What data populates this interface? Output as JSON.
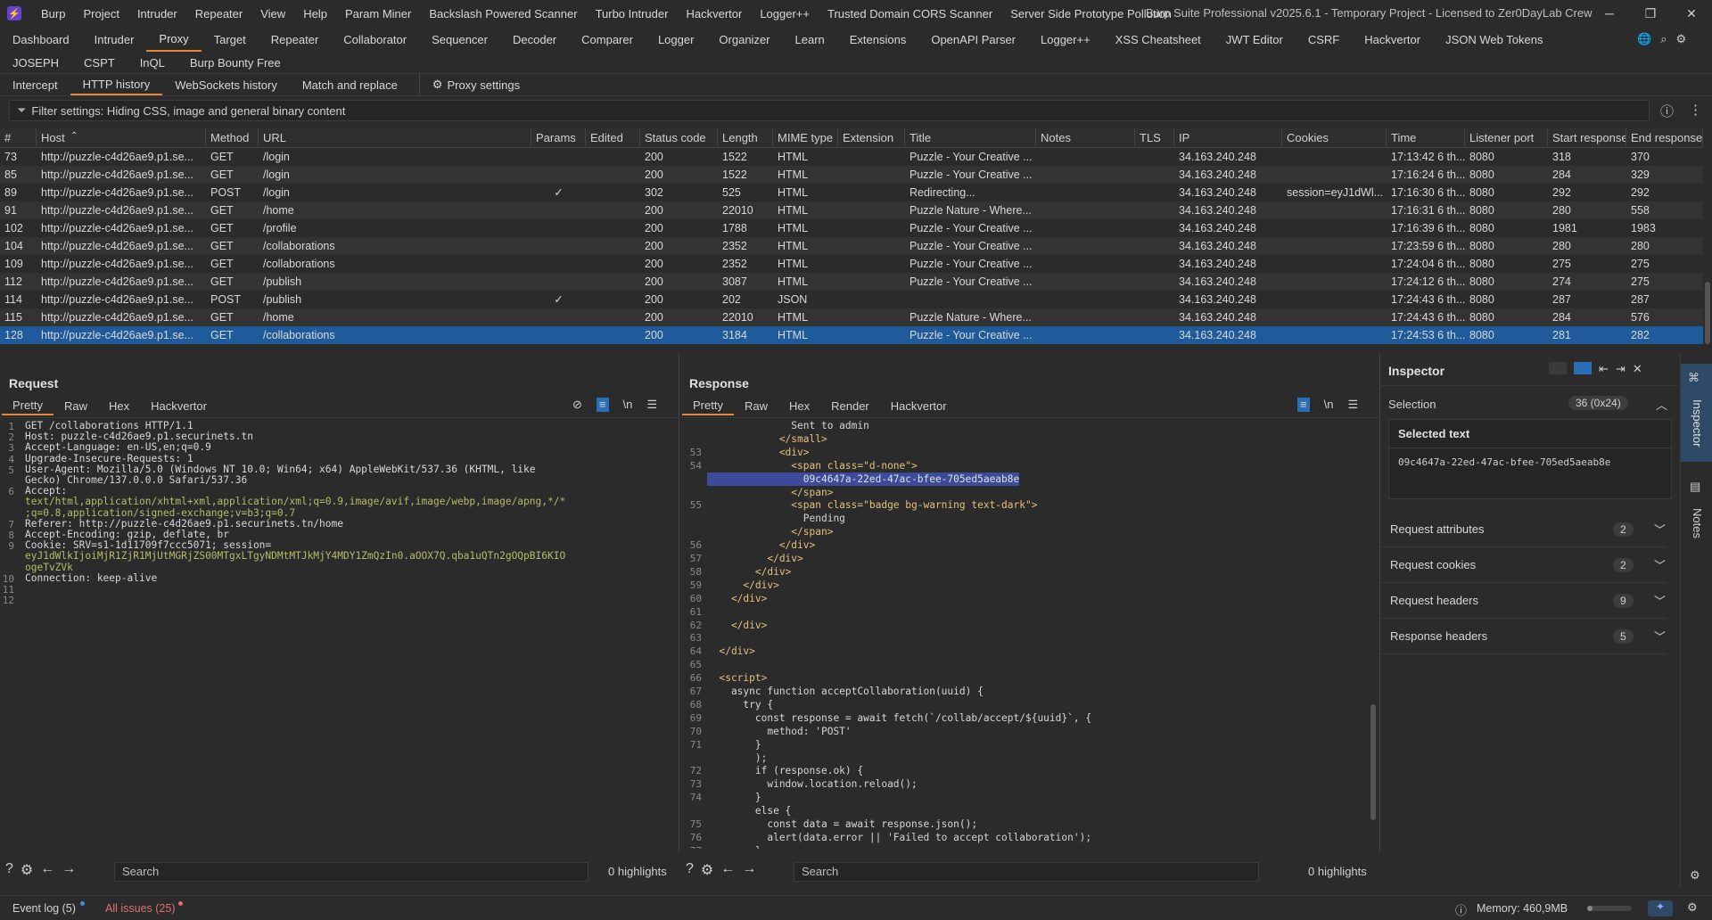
{
  "menubar": {
    "items": [
      "Burp",
      "Project",
      "Intruder",
      "Repeater",
      "View",
      "Help",
      "Param Miner",
      "Backslash Powered Scanner",
      "Turbo Intruder",
      "Hackvertor",
      "Logger++",
      "Trusted Domain CORS Scanner",
      "Server Side Prototype Pollution"
    ],
    "window_title": "Burp Suite Professional v2025.6.1 - Temporary Project - Licensed to Zer0DayLab Crew"
  },
  "main_tabs_row1": [
    "Dashboard",
    "Intruder",
    "Proxy",
    "Target",
    "Repeater",
    "Collaborator",
    "Sequencer",
    "Decoder",
    "Comparer",
    "Logger",
    "Organizer",
    "Learn",
    "Extensions",
    "OpenAPI Parser",
    "Logger++",
    "XSS Cheatsheet",
    "JWT Editor",
    "CSRF",
    "Hackvertor",
    "JSON Web Tokens"
  ],
  "main_tabs_row2": [
    "JOSEPH",
    "CSPT",
    "InQL",
    "Burp Bounty Free"
  ],
  "proxy_tabs": [
    "Intercept",
    "HTTP history",
    "WebSockets history",
    "Match and replace"
  ],
  "proxy_settings_label": "Proxy settings",
  "filter_text": "Filter settings: Hiding CSS, image and general binary content",
  "table": {
    "headers": [
      "#",
      "Host",
      "Method",
      "URL",
      "Params",
      "Edited",
      "Status code",
      "Length",
      "MIME type",
      "Extension",
      "Title",
      "Notes",
      "TLS",
      "IP",
      "Cookies",
      "Time",
      "Listener port",
      "Start response",
      "End response"
    ],
    "rows": [
      {
        "id": "73",
        "host": "http://puzzle-c4d26ae9.p1.se...",
        "method": "GET",
        "url": "/login",
        "params": "",
        "status": "200",
        "length": "1522",
        "mime": "HTML",
        "title": "Puzzle - Your Creative ...",
        "ip": "34.163.240.248",
        "cookies": "",
        "time": "17:13:42 6 th...",
        "port": "8080",
        "start": "318",
        "end": "370"
      },
      {
        "id": "85",
        "host": "http://puzzle-c4d26ae9.p1.se...",
        "method": "GET",
        "url": "/login",
        "params": "",
        "status": "200",
        "length": "1522",
        "mime": "HTML",
        "title": "Puzzle - Your Creative ...",
        "ip": "34.163.240.248",
        "cookies": "",
        "time": "17:16:24 6 th...",
        "port": "8080",
        "start": "284",
        "end": "329"
      },
      {
        "id": "89",
        "host": "http://puzzle-c4d26ae9.p1.se...",
        "method": "POST",
        "url": "/login",
        "params": "✓",
        "status": "302",
        "length": "525",
        "mime": "HTML",
        "title": "Redirecting...",
        "ip": "34.163.240.248",
        "cookies": "session=eyJ1dWl...",
        "time": "17:16:30 6 th...",
        "port": "8080",
        "start": "292",
        "end": "292"
      },
      {
        "id": "91",
        "host": "http://puzzle-c4d26ae9.p1.se...",
        "method": "GET",
        "url": "/home",
        "params": "",
        "status": "200",
        "length": "22010",
        "mime": "HTML",
        "title": "Puzzle Nature - Where...",
        "ip": "34.163.240.248",
        "cookies": "",
        "time": "17:16:31 6 th...",
        "port": "8080",
        "start": "280",
        "end": "558"
      },
      {
        "id": "102",
        "host": "http://puzzle-c4d26ae9.p1.se...",
        "method": "GET",
        "url": "/profile",
        "params": "",
        "status": "200",
        "length": "1788",
        "mime": "HTML",
        "title": "Puzzle - Your Creative ...",
        "ip": "34.163.240.248",
        "cookies": "",
        "time": "17:16:39 6 th...",
        "port": "8080",
        "start": "1981",
        "end": "1983"
      },
      {
        "id": "104",
        "host": "http://puzzle-c4d26ae9.p1.se...",
        "method": "GET",
        "url": "/collaborations",
        "params": "",
        "status": "200",
        "length": "2352",
        "mime": "HTML",
        "title": "Puzzle - Your Creative ...",
        "ip": "34.163.240.248",
        "cookies": "",
        "time": "17:23:59 6 th...",
        "port": "8080",
        "start": "280",
        "end": "280"
      },
      {
        "id": "109",
        "host": "http://puzzle-c4d26ae9.p1.se...",
        "method": "GET",
        "url": "/collaborations",
        "params": "",
        "status": "200",
        "length": "2352",
        "mime": "HTML",
        "title": "Puzzle - Your Creative ...",
        "ip": "34.163.240.248",
        "cookies": "",
        "time": "17:24:04 6 th...",
        "port": "8080",
        "start": "275",
        "end": "275"
      },
      {
        "id": "112",
        "host": "http://puzzle-c4d26ae9.p1.se...",
        "method": "GET",
        "url": "/publish",
        "params": "",
        "status": "200",
        "length": "3087",
        "mime": "HTML",
        "title": "Puzzle - Your Creative ...",
        "ip": "34.163.240.248",
        "cookies": "",
        "time": "17:24:12 6 th...",
        "port": "8080",
        "start": "274",
        "end": "275"
      },
      {
        "id": "114",
        "host": "http://puzzle-c4d26ae9.p1.se...",
        "method": "POST",
        "url": "/publish",
        "params": "✓",
        "status": "200",
        "length": "202",
        "mime": "JSON",
        "title": "",
        "ip": "34.163.240.248",
        "cookies": "",
        "time": "17:24:43 6 th...",
        "port": "8080",
        "start": "287",
        "end": "287"
      },
      {
        "id": "115",
        "host": "http://puzzle-c4d26ae9.p1.se...",
        "method": "GET",
        "url": "/home",
        "params": "",
        "status": "200",
        "length": "22010",
        "mime": "HTML",
        "title": "Puzzle Nature - Where...",
        "ip": "34.163.240.248",
        "cookies": "",
        "time": "17:24:43 6 th...",
        "port": "8080",
        "start": "284",
        "end": "576"
      },
      {
        "id": "128",
        "host": "http://puzzle-c4d26ae9.p1.se...",
        "method": "GET",
        "url": "/collaborations",
        "params": "",
        "status": "200",
        "length": "3184",
        "mime": "HTML",
        "title": "Puzzle - Your Creative ...",
        "ip": "34.163.240.248",
        "cookies": "",
        "time": "17:24:53 6 th...",
        "port": "8080",
        "start": "281",
        "end": "282"
      }
    ]
  },
  "request": {
    "title": "Request",
    "tabs": [
      "Pretty",
      "Raw",
      "Hex",
      "Hackvertor"
    ],
    "lines": [
      {
        "n": "1",
        "text": "GET /collaborations HTTP/1.1"
      },
      {
        "n": "2",
        "text": "Host: puzzle-c4d26ae9.p1.securinets.tn"
      },
      {
        "n": "3",
        "text": "Accept-Language: en-US,en;q=0.9"
      },
      {
        "n": "4",
        "text": "Upgrade-Insecure-Requests: 1"
      },
      {
        "n": "5",
        "text": "User-Agent: Mozilla/5.0 (Windows NT 10.0; Win64; x64) AppleWebKit/537.36 (KHTML, like"
      },
      {
        "n": "",
        "text": "Gecko) Chrome/137.0.0.0 Safari/537.36"
      },
      {
        "n": "6",
        "text": "Accept:"
      },
      {
        "n": "",
        "text": "text/html,application/xhtml+xml,application/xml;q=0.9,image/avif,image/webp,image/apng,*/*"
      },
      {
        "n": "",
        "text": ";q=0.8,application/signed-exchange;v=b3;q=0.7"
      },
      {
        "n": "7",
        "text": "Referer: http://puzzle-c4d26ae9.p1.securinets.tn/home"
      },
      {
        "n": "8",
        "text": "Accept-Encoding: gzip, deflate, br"
      },
      {
        "n": "9",
        "text": "Cookie: SRV=s1-1d11709f7ccc5071; session="
      },
      {
        "n": "",
        "text": "eyJ1dWlkIjoiMjR1ZjR1MjUtMGRjZS00MTgxLTgyNDMtMTJkMjY4MDY1ZmQzIn0.aOOX7Q.qba1uQTn2gOQpBI6KIO"
      },
      {
        "n": "",
        "text": "ogeTvZVk"
      },
      {
        "n": "10",
        "text": "Connection: keep-alive"
      },
      {
        "n": "11",
        "text": ""
      },
      {
        "n": "12",
        "text": ""
      }
    ],
    "search_placeholder": "Search",
    "highlights": "0 highlights"
  },
  "response": {
    "title": "Response",
    "tabs": [
      "Pretty",
      "Raw",
      "Hex",
      "Render",
      "Hackvertor"
    ],
    "lines": [
      {
        "n": "",
        "text": "              Sent to admin"
      },
      {
        "n": "",
        "text": "            </small>"
      },
      {
        "n": "53",
        "text": "            <div>"
      },
      {
        "n": "54",
        "text": "              <span class=\"d-none\">"
      },
      {
        "n": "",
        "text": "                09c4647a-22ed-47ac-bfee-705ed5aeab8e"
      },
      {
        "n": "",
        "text": "              </span>"
      },
      {
        "n": "55",
        "text": "              <span class=\"badge bg-warning text-dark\">"
      },
      {
        "n": "",
        "text": "                Pending"
      },
      {
        "n": "",
        "text": "              </span>"
      },
      {
        "n": "56",
        "text": "            </div>"
      },
      {
        "n": "57",
        "text": "          </div>"
      },
      {
        "n": "58",
        "text": "        </div>"
      },
      {
        "n": "59",
        "text": "      </div>"
      },
      {
        "n": "60",
        "text": "    </div>"
      },
      {
        "n": "61",
        "text": ""
      },
      {
        "n": "62",
        "text": "    </div>"
      },
      {
        "n": "63",
        "text": ""
      },
      {
        "n": "64",
        "text": "  </div>"
      },
      {
        "n": "65",
        "text": ""
      },
      {
        "n": "66",
        "text": "  <script>"
      },
      {
        "n": "67",
        "text": "    async function acceptCollaboration(uuid) {"
      },
      {
        "n": "68",
        "text": "      try {"
      },
      {
        "n": "69",
        "text": "        const response = await fetch(`/collab/accept/${uuid}`, {"
      },
      {
        "n": "70",
        "text": "          method: 'POST'"
      },
      {
        "n": "71",
        "text": "        }"
      },
      {
        "n": "",
        "text": "        );"
      },
      {
        "n": "72",
        "text": "        if (response.ok) {"
      },
      {
        "n": "73",
        "text": "          window.location.reload();"
      },
      {
        "n": "74",
        "text": "        }"
      },
      {
        "n": "",
        "text": "        else {"
      },
      {
        "n": "75",
        "text": "          const data = await response.json();"
      },
      {
        "n": "76",
        "text": "          alert(data.error || 'Failed to accept collaboration');"
      },
      {
        "n": "77",
        "text": "        }"
      }
    ],
    "search_placeholder": "Search",
    "highlights": "0 highlights"
  },
  "inspector": {
    "title": "Inspector",
    "selection_label": "Selection",
    "selection_badge": "36 (0x24)",
    "selected_text_label": "Selected text",
    "selected_text": "09c4647a-22ed-47ac-bfee-705ed5aeab8e",
    "sections": [
      {
        "label": "Request attributes",
        "count": "2"
      },
      {
        "label": "Request cookies",
        "count": "2"
      },
      {
        "label": "Request headers",
        "count": "9"
      },
      {
        "label": "Response headers",
        "count": "5"
      }
    ],
    "side_tabs": [
      "Inspector",
      "Notes"
    ]
  },
  "statusbar": {
    "event_log": "Event log (5)",
    "all_issues": "All issues (25)",
    "memory": "Memory: 460,9MB"
  },
  "colors": {
    "accent": "#e8833a",
    "selected_row": "#1f5a9a",
    "code_green": "#b5bd68",
    "tag_yellow": "#e6c07b"
  }
}
